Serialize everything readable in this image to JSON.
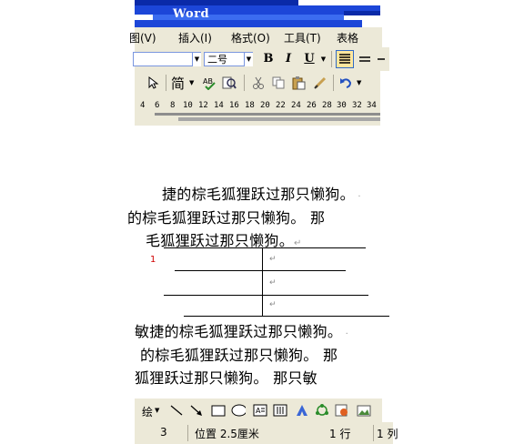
{
  "title": {
    "app_name": "Word"
  },
  "menu": [
    {
      "label": "图(V)"
    },
    {
      "label": "插入(I)"
    },
    {
      "label": "格式(O)"
    },
    {
      "label": "工具(T)"
    },
    {
      "label": "表格"
    }
  ],
  "format_toolbar": {
    "font_size": "二号",
    "bold": "B",
    "italic": "I",
    "underline": "U"
  },
  "standard_toolbar": {
    "traditional_label": "简"
  },
  "ruler": {
    "ticks": [
      "4",
      "6",
      "8",
      "10",
      "12",
      "14",
      "16",
      "18",
      "20",
      "22",
      "24",
      "26",
      "28",
      "30",
      "32",
      "34"
    ]
  },
  "document": {
    "lines_top": [
      "捷的棕毛狐狸跃过那只懒狗。",
      "的棕毛狐狸跃过那只懒狗。 那",
      "毛狐狸跃过那只懒狗。"
    ],
    "paragraph_mark": "↵",
    "table_marker": "1",
    "lines_bottom": [
      "敏捷的棕毛狐狸跃过那只懒狗。",
      "的棕毛狐狸跃过那只懒狗。 那",
      "狐狸跃过那只懒狗。 那只敏"
    ]
  },
  "drawing_toolbar": {
    "draw_label": "绘"
  },
  "status_bar": {
    "page": "3",
    "position": "位置 2.5厘米",
    "line": "1 行",
    "column": "1 列"
  },
  "colors": {
    "title_blue": "#1c46d8",
    "toolbar_bg": "#ece9d8",
    "active_button": "#ffe79e"
  }
}
